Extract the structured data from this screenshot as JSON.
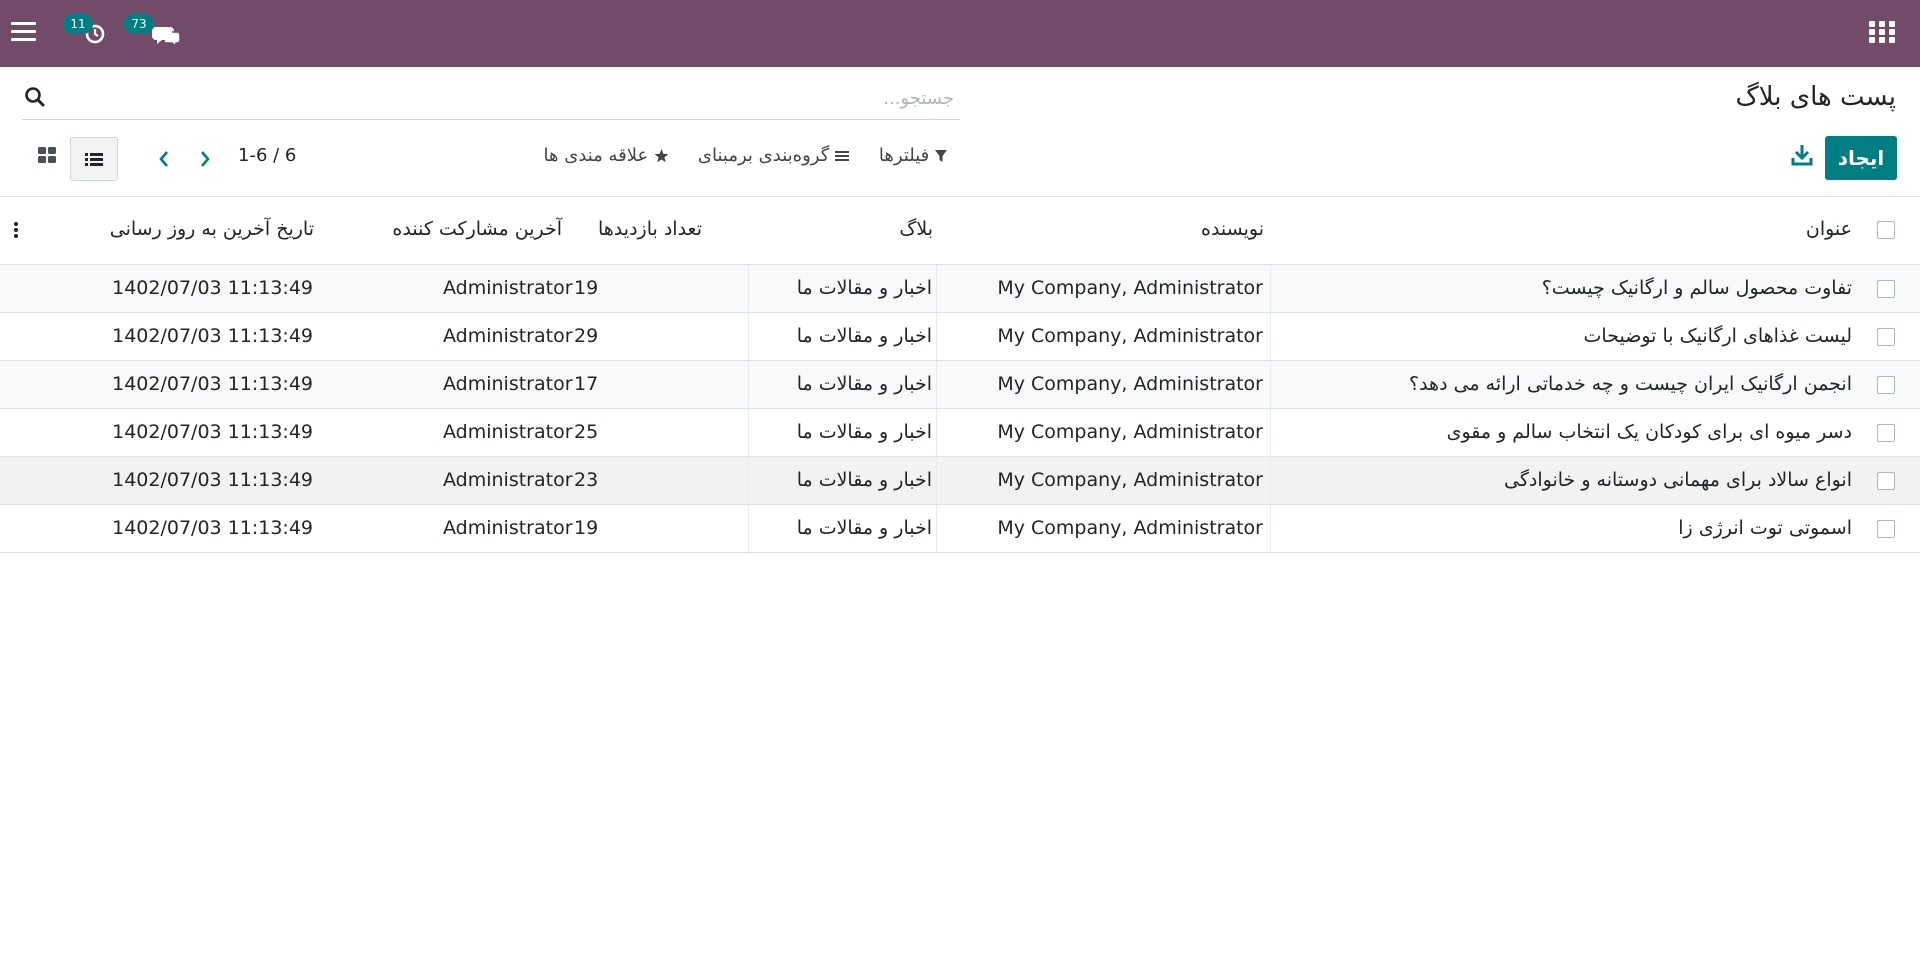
{
  "navbar": {
    "activity_count": "11",
    "message_count": "73",
    "color": "#714B67"
  },
  "control_panel": {
    "title": "پست های بلاگ",
    "search": {
      "placeholder": "جستجو...",
      "value": ""
    },
    "create_label": "ایجاد",
    "filters_label": "فیلترها",
    "group_by_label": "گروه‌بندی برمبنای",
    "favorites_label": "علاقه مندی ها",
    "pager": "1-6 / 6",
    "accent_color": "#017e84"
  },
  "table": {
    "columns": {
      "title": "عنوان",
      "author": "نویسنده",
      "blog": "بلاگ",
      "visits": "تعداد بازدیدها",
      "last_contributor": "آخرین مشارکت کننده",
      "last_updated": "تاریخ آخرین به روز رسانی"
    },
    "rows": [
      {
        "title": "تفاوت محصول سالم و ارگانیک چیست؟",
        "author": "My Company, Administrator",
        "blog": "اخبار و مقالات ما",
        "visits": "19",
        "last_contributor": "Administrator",
        "last_updated": "1402/07/03 11:13:49"
      },
      {
        "title": "لیست غذاهای ارگانیک با توضیحات",
        "author": "My Company, Administrator",
        "blog": "اخبار و مقالات ما",
        "visits": "29",
        "last_contributor": "Administrator",
        "last_updated": "1402/07/03 11:13:49"
      },
      {
        "title": "انجمن ارگانیک ایران چیست و چه خدماتی ارائه می دهد؟",
        "author": "My Company, Administrator",
        "blog": "اخبار و مقالات ما",
        "visits": "17",
        "last_contributor": "Administrator",
        "last_updated": "1402/07/03 11:13:49"
      },
      {
        "title": "دسر میوه ای برای کودکان یک انتخاب سالم و مقوی",
        "author": "My Company, Administrator",
        "blog": "اخبار و مقالات ما",
        "visits": "25",
        "last_contributor": "Administrator",
        "last_updated": "1402/07/03 11:13:49"
      },
      {
        "title": "انواع سالاد برای مهمانی دوستانه و خانوادگی",
        "author": "My Company, Administrator",
        "blog": "اخبار و مقالات ما",
        "visits": "23",
        "last_contributor": "Administrator",
        "last_updated": "1402/07/03 11:13:49"
      },
      {
        "title": "اسموتی توت انرژی زا",
        "author": "My Company, Administrator",
        "blog": "اخبار و مقالات ما",
        "visits": "19",
        "last_contributor": "Administrator",
        "last_updated": "1402/07/03 11:13:49"
      }
    ]
  }
}
